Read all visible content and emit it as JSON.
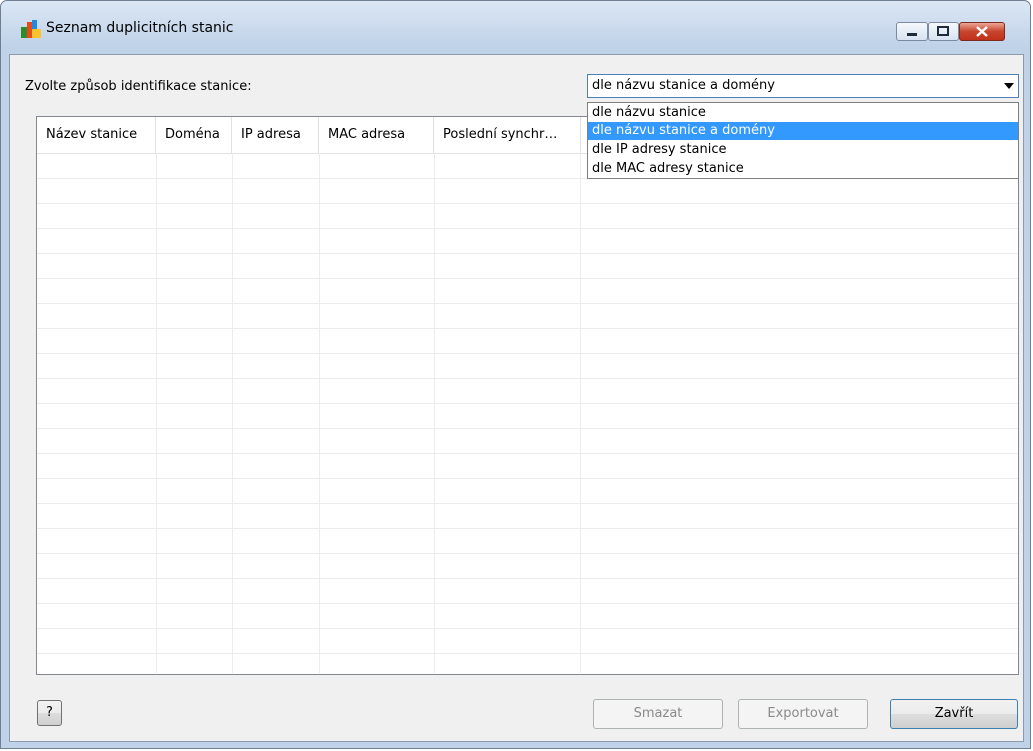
{
  "window": {
    "title": "Seznam duplicitních stanic"
  },
  "form": {
    "label": "Zvolte způsob identifikace stanice:",
    "combo_value": "dle názvu stanice a domény",
    "options": [
      "dle názvu stanice",
      "dle názvu stanice a domény",
      "dle IP adresy stanice",
      "dle MAC adresy stanice"
    ],
    "selected_index": 1
  },
  "table": {
    "columns": [
      "Název stanice",
      "Doména",
      "IP adresa",
      "MAC adresa",
      "Poslední synchr…"
    ]
  },
  "buttons": {
    "help": "?",
    "delete": "Smazat",
    "export": "Exportovat",
    "close": "Zavřít"
  },
  "icons": {
    "app": "avg-logo-icon",
    "minimize": "minimize-icon",
    "maximize": "maximize-icon",
    "close": "close-icon",
    "dropdown": "chevron-down-icon"
  },
  "colors": {
    "selection": "#3399ff",
    "close_button": "#c8452d"
  }
}
